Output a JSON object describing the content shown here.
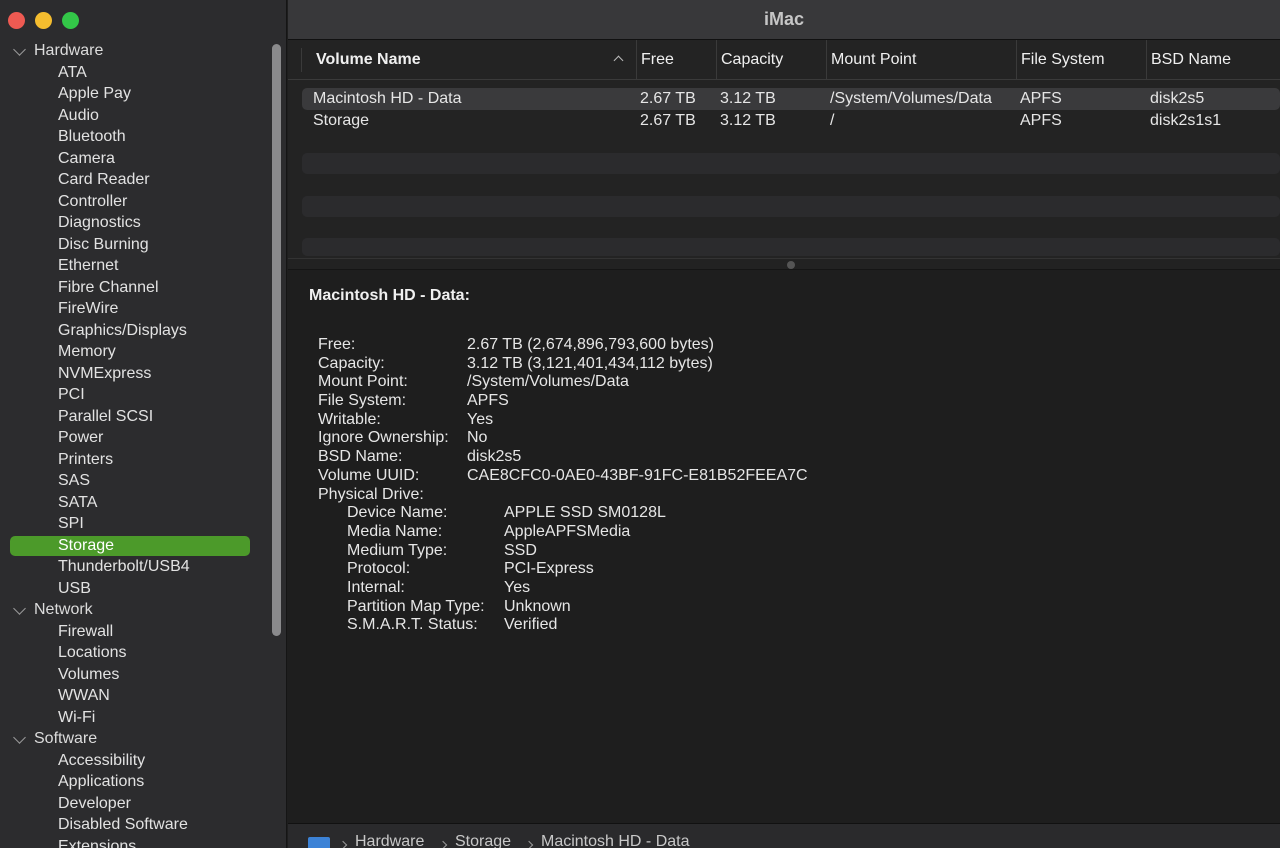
{
  "window": {
    "title": "iMac"
  },
  "sidebar": {
    "groups": [
      {
        "label": "Hardware",
        "items": [
          "ATA",
          "Apple Pay",
          "Audio",
          "Bluetooth",
          "Camera",
          "Card Reader",
          "Controller",
          "Diagnostics",
          "Disc Burning",
          "Ethernet",
          "Fibre Channel",
          "FireWire",
          "Graphics/Displays",
          "Memory",
          "NVMExpress",
          "PCI",
          "Parallel SCSI",
          "Power",
          "Printers",
          "SAS",
          "SATA",
          "SPI",
          "Storage",
          "Thunderbolt/USB4",
          "USB"
        ]
      },
      {
        "label": "Network",
        "items": [
          "Firewall",
          "Locations",
          "Volumes",
          "WWAN",
          "Wi-Fi"
        ]
      },
      {
        "label": "Software",
        "items": [
          "Accessibility",
          "Applications",
          "Developer",
          "Disabled Software",
          "Extensions"
        ]
      }
    ],
    "selected": "Storage",
    "accent_color": "#4c9a2a"
  },
  "table": {
    "columns": [
      "Volume Name",
      "Free",
      "Capacity",
      "Mount Point",
      "File System",
      "BSD Name"
    ],
    "sort_icon": "chevron-up-icon",
    "rows": [
      [
        "Macintosh HD - Data",
        "2.67 TB",
        "3.12 TB",
        "/System/Volumes/Data",
        "APFS",
        "disk2s5"
      ],
      [
        "Storage",
        "2.67 TB",
        "3.12 TB",
        "/",
        "APFS",
        "disk2s1s1"
      ]
    ],
    "selected_row": 0
  },
  "detail": {
    "title": "Macintosh HD - Data:",
    "fields": [
      {
        "key": "Free:",
        "value": "2.67 TB (2,674,896,793,600 bytes)"
      },
      {
        "key": "Capacity:",
        "value": "3.12 TB (3,121,401,434,112 bytes)"
      },
      {
        "key": "Mount Point:",
        "value": "/System/Volumes/Data"
      },
      {
        "key": "File System:",
        "value": "APFS"
      },
      {
        "key": "Writable:",
        "value": "Yes"
      },
      {
        "key": "Ignore Ownership:",
        "value": "No"
      },
      {
        "key": "BSD Name:",
        "value": "disk2s5"
      },
      {
        "key": "Volume UUID:",
        "value": "CAE8CFC0-0AE0-43BF-91FC-E81B52FEEA7C"
      },
      {
        "key": "Physical Drive:",
        "value": ""
      }
    ],
    "physical_drive": [
      {
        "key": "Device Name:",
        "value": "APPLE SSD SM0128L"
      },
      {
        "key": "Media Name:",
        "value": "AppleAPFSMedia"
      },
      {
        "key": "Medium Type:",
        "value": "SSD"
      },
      {
        "key": "Protocol:",
        "value": "PCI-Express"
      },
      {
        "key": "Internal:",
        "value": "Yes"
      },
      {
        "key": "Partition Map Type:",
        "value": "Unknown"
      },
      {
        "key": "S.M.A.R.T. Status:",
        "value": "Verified"
      }
    ]
  },
  "pathbar": {
    "icon": "computer-icon",
    "crumbs": [
      "Hardware",
      "Storage",
      "Macintosh HD - Data"
    ]
  }
}
